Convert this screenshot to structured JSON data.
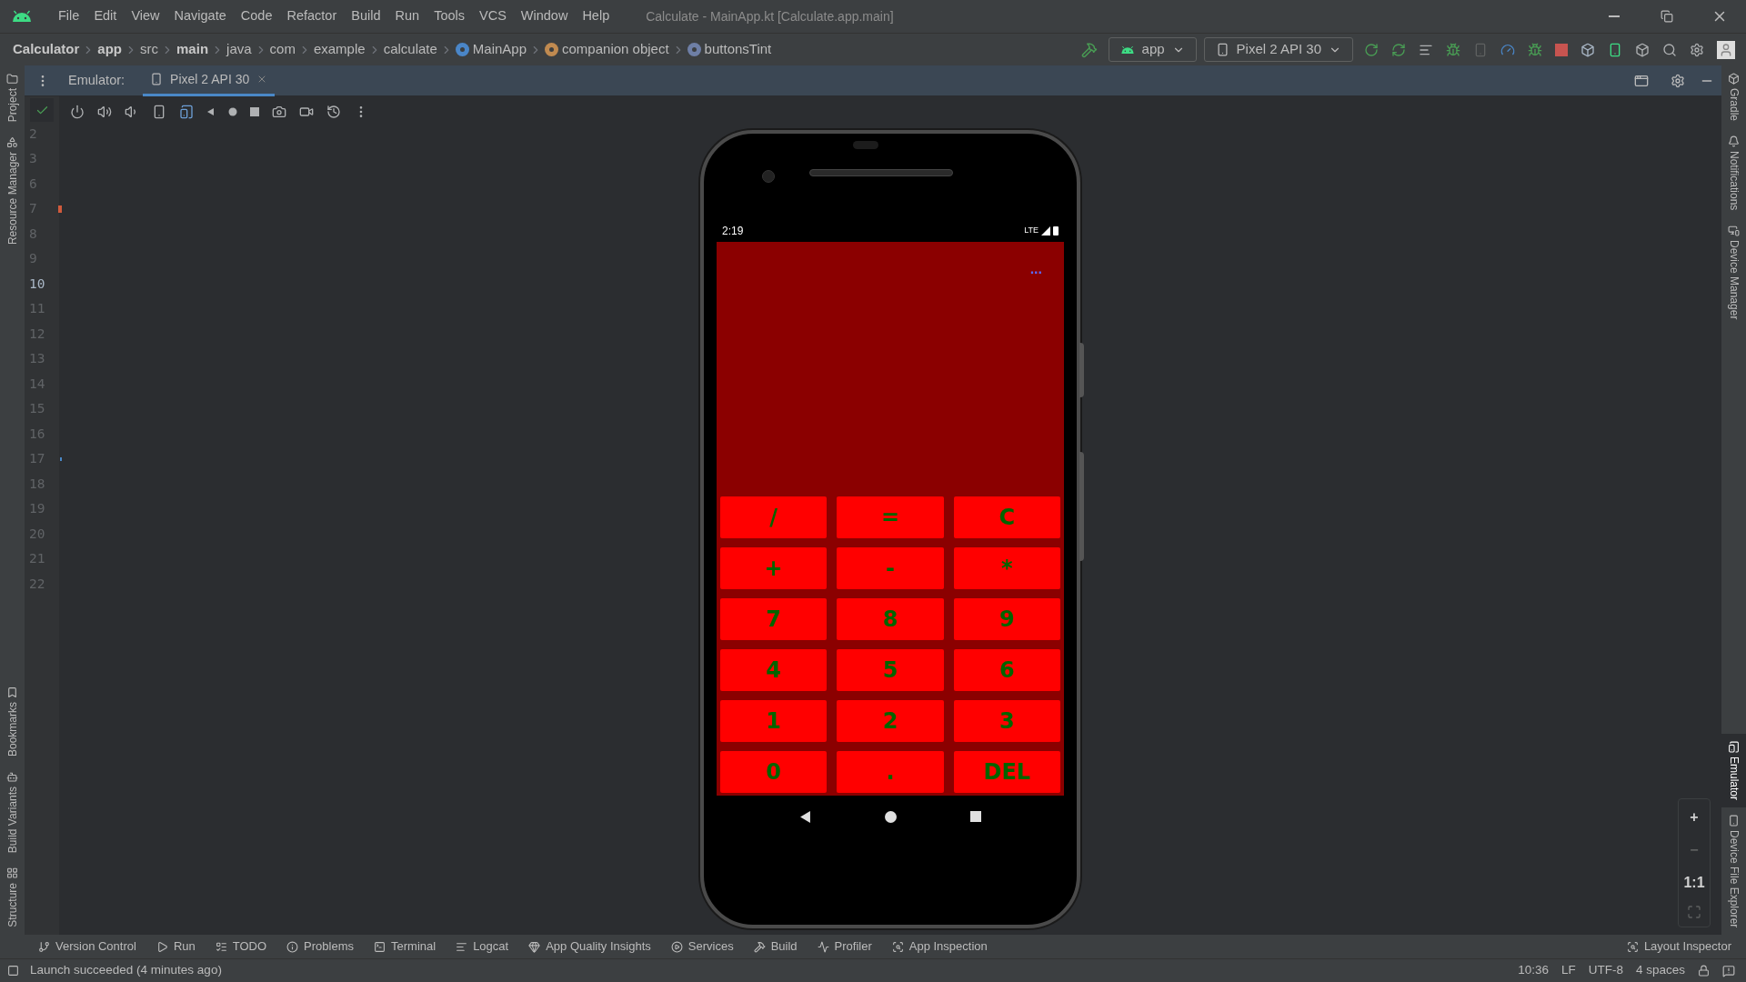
{
  "menu_bar": {
    "items": [
      "File",
      "Edit",
      "View",
      "Navigate",
      "Code",
      "Refactor",
      "Build",
      "Run",
      "Tools",
      "VCS",
      "Window",
      "Help"
    ],
    "title": "Calculate - MainApp.kt [Calculate.app.main]"
  },
  "breadcrumbs": [
    {
      "label": "Calculator",
      "bold": true,
      "kind": "plain"
    },
    {
      "label": "app",
      "bold": true,
      "kind": "plain"
    },
    {
      "label": "src",
      "bold": false,
      "kind": "plain"
    },
    {
      "label": "main",
      "bold": true,
      "kind": "plain"
    },
    {
      "label": "java",
      "bold": false,
      "kind": "plain"
    },
    {
      "label": "com",
      "bold": false,
      "kind": "plain"
    },
    {
      "label": "example",
      "bold": false,
      "kind": "plain"
    },
    {
      "label": "calculate",
      "bold": false,
      "kind": "plain"
    },
    {
      "label": "MainApp",
      "bold": false,
      "kind": "class"
    },
    {
      "label": "companion object",
      "bold": false,
      "kind": "object"
    },
    {
      "label": "buttonsTint",
      "bold": false,
      "kind": "property"
    }
  ],
  "run_toolbar": {
    "configuration": "app",
    "device": "Pixel 2 API 30"
  },
  "emulator": {
    "label": "Emulator:",
    "tab": "Pixel 2 API 30"
  },
  "left_stripe": [
    {
      "label": "Project",
      "selected": false,
      "kind": "project"
    },
    {
      "label": "Resource Manager",
      "selected": false,
      "kind": "resources"
    },
    {
      "label": "Bookmarks",
      "selected": false,
      "kind": "bookmark"
    },
    {
      "label": "Build Variants",
      "selected": false,
      "kind": "android"
    },
    {
      "label": "Structure",
      "selected": false,
      "kind": "structure"
    }
  ],
  "right_stripe": [
    {
      "label": "Gradle",
      "selected": false,
      "kind": "gradle"
    },
    {
      "label": "Notifications",
      "selected": false,
      "kind": "bell"
    },
    {
      "label": "Device Manager",
      "selected": false,
      "kind": "devices"
    },
    {
      "label": "Emulator",
      "selected": true,
      "kind": "emulator"
    },
    {
      "label": "Device File Explorer",
      "selected": false,
      "kind": "phone"
    }
  ],
  "gutter": [
    {
      "number": "2",
      "current": false
    },
    {
      "number": "3",
      "current": false
    },
    {
      "number": "6",
      "current": false
    },
    {
      "number": "7",
      "current": false,
      "kind": "error"
    },
    {
      "number": "8",
      "current": false
    },
    {
      "number": "9",
      "current": false
    },
    {
      "number": "10",
      "current": true
    },
    {
      "number": "11",
      "current": false
    },
    {
      "number": "12",
      "current": false
    },
    {
      "number": "13",
      "current": false
    },
    {
      "number": "14",
      "current": false
    },
    {
      "number": "15",
      "current": false
    },
    {
      "number": "16",
      "current": false
    },
    {
      "number": "17",
      "current": false,
      "kind": "change"
    },
    {
      "number": "18",
      "current": false
    },
    {
      "number": "19",
      "current": false
    },
    {
      "number": "20",
      "current": false
    },
    {
      "number": "21",
      "current": false
    },
    {
      "number": "22",
      "current": false
    }
  ],
  "phone": {
    "time": "2:19",
    "network": "LTE",
    "display": "...",
    "buttons": [
      "/",
      "=",
      "C",
      "+",
      "-",
      "*",
      "7",
      "8",
      "9",
      "4",
      "5",
      "6",
      "1",
      "2",
      "3",
      "0",
      ".",
      "DEL"
    ]
  },
  "zoom_controls": [
    {
      "label": "+",
      "disabled": false
    },
    {
      "label": "−",
      "disabled": true
    },
    {
      "label": "1:1",
      "disabled": false
    }
  ],
  "bottom_tools": [
    {
      "label": "Version Control",
      "kind": "vcs"
    },
    {
      "label": "Run",
      "kind": "run"
    },
    {
      "label": "TODO",
      "kind": "todo"
    },
    {
      "label": "Problems",
      "kind": "problems"
    },
    {
      "label": "Terminal",
      "kind": "terminal"
    },
    {
      "label": "Logcat",
      "kind": "logcat"
    },
    {
      "label": "App Quality Insights",
      "kind": "insights"
    },
    {
      "label": "Services",
      "kind": "services"
    },
    {
      "label": "Build",
      "kind": "build"
    },
    {
      "label": "Profiler",
      "kind": "profiler"
    },
    {
      "label": "App Inspection",
      "kind": "inspection"
    }
  ],
  "layout_inspector": "Layout Inspector",
  "status": {
    "message": "Launch succeeded (4 minutes ago)",
    "items": [
      "10:36",
      "LF",
      "UTF-8",
      "4 spaces"
    ]
  }
}
